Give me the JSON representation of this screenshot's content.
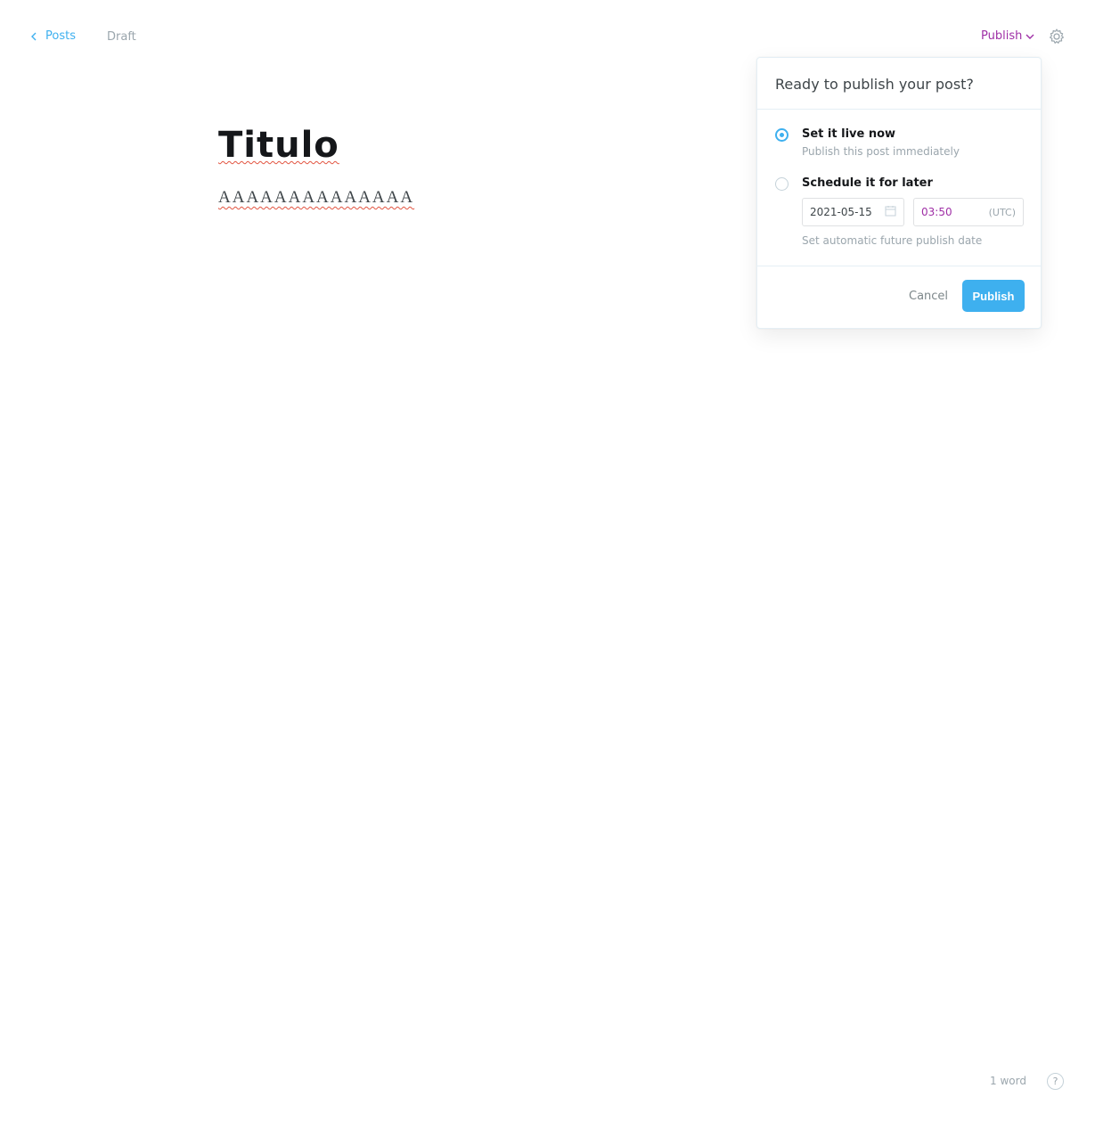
{
  "header": {
    "back_label": "Posts",
    "status": "Draft",
    "publish_menu_label": "Publish"
  },
  "editor": {
    "title": "Titulo",
    "body": "AAAAAAAAAAAAAA"
  },
  "publish_popover": {
    "heading": "Ready to publish your post?",
    "options": [
      {
        "label": "Set it live now",
        "description": "Publish this post immediately",
        "selected": true
      },
      {
        "label": "Schedule it for later",
        "selected": false
      }
    ],
    "date_value": "2021-05-15",
    "time_value": "03:50",
    "timezone": "(UTC)",
    "schedule_hint": "Set automatic future publish date",
    "cancel_label": "Cancel",
    "publish_label": "Publish"
  },
  "footer": {
    "word_count": "1 word",
    "help_label": "?"
  },
  "colors": {
    "accent": "#3eb0ef",
    "publish_menu": "#9f2fa6",
    "spell_error": "#e25440"
  }
}
